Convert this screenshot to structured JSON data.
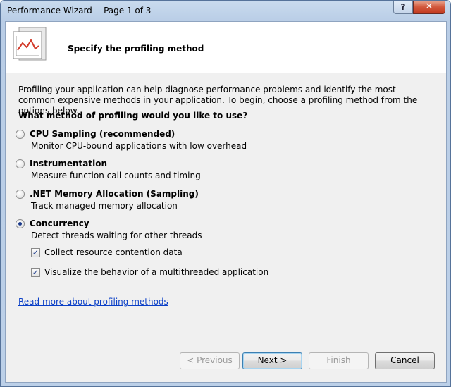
{
  "window": {
    "title": "Performance Wizard -- Page 1 of 3",
    "help_label": "?",
    "close_label": "✕"
  },
  "header": {
    "title": "Specify the profiling method"
  },
  "intro": "Profiling your application can help diagnose performance problems and identify the most common expensive methods in your application. To begin, choose a profiling method from the options below.",
  "question": "What method of profiling would you like to use?",
  "options": [
    {
      "label": "CPU Sampling (recommended)",
      "description": "Monitor CPU-bound applications with low overhead",
      "selected": false
    },
    {
      "label": "Instrumentation",
      "description": "Measure function call counts and timing",
      "selected": false
    },
    {
      "label": ".NET Memory Allocation (Sampling)",
      "description": "Track managed memory allocation",
      "selected": false
    },
    {
      "label": "Concurrency",
      "description": "Detect threads waiting for other threads",
      "selected": true
    }
  ],
  "checkboxes": [
    {
      "label": "Collect resource contention data",
      "checked": true
    },
    {
      "label": "Visualize the behavior of a multithreaded application",
      "checked": true
    }
  ],
  "link": "Read more about profiling methods",
  "buttons": {
    "previous": "< Previous",
    "next": "Next >",
    "finish": "Finish",
    "cancel": "Cancel"
  },
  "check_glyph": "✓",
  "colors": {
    "link": "#0a3fc7",
    "close": "#c2391f",
    "radio_dot": "#1b3a8a"
  }
}
